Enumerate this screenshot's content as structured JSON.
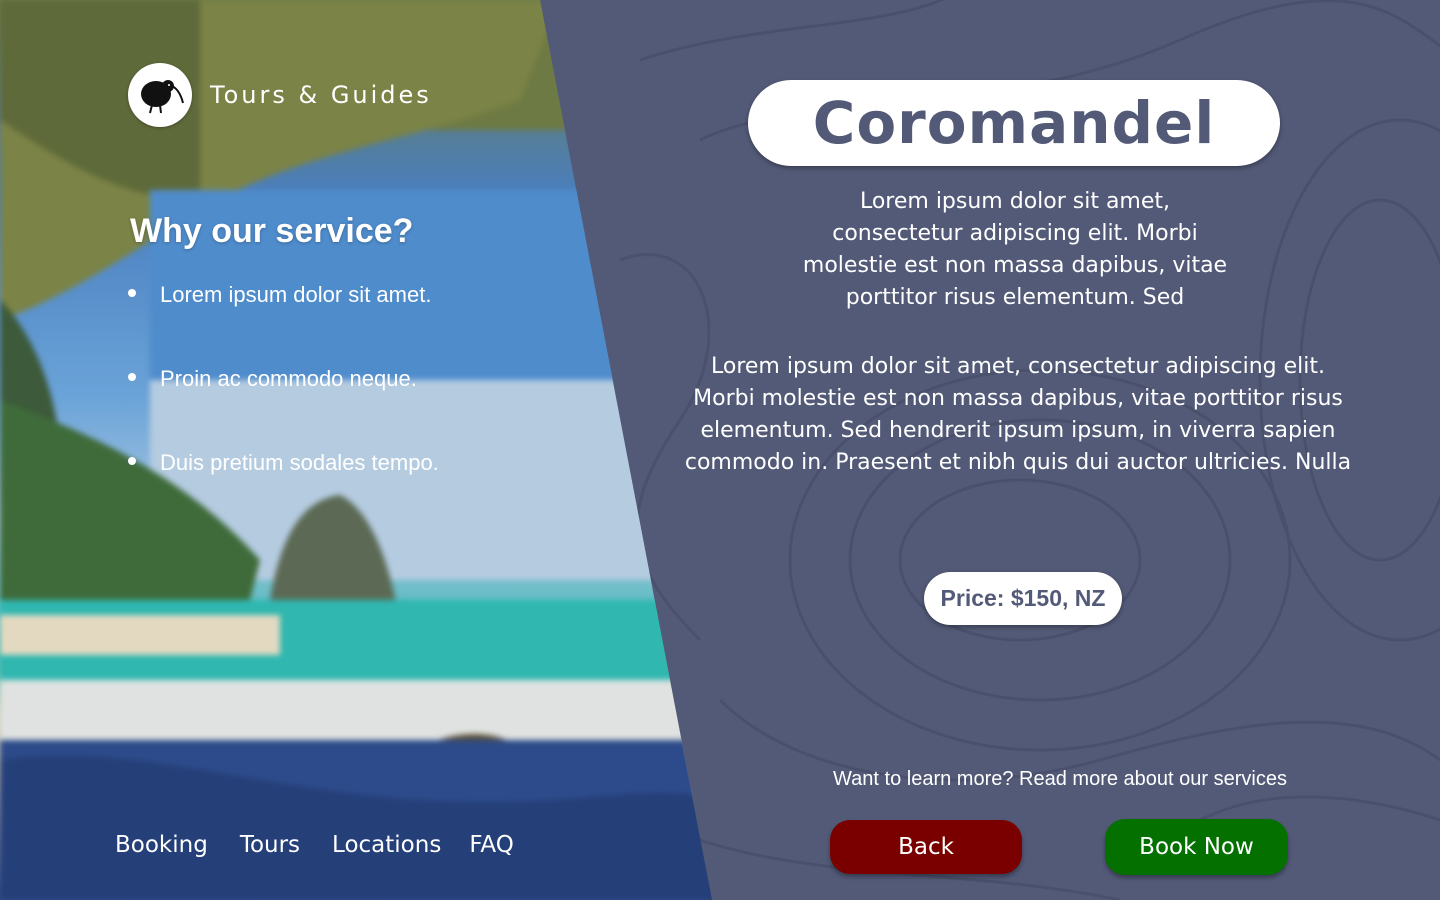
{
  "brand": {
    "name": "Tours & Guides",
    "logo_icon": "kiwi-bird-icon"
  },
  "why": {
    "title": "Why our service?",
    "items": [
      "Lorem ipsum dolor sit amet.",
      "Proin ac commodo neque.",
      "Duis pretium sodales tempo."
    ]
  },
  "nav": {
    "booking": "Booking",
    "tours": "Tours",
    "locations": "Locations",
    "faq": "FAQ"
  },
  "location": {
    "title": "Coromandel",
    "intro": "Lorem ipsum dolor sit amet, consectetur adipiscing elit. Morbi molestie est non massa dapibus, vitae porttitor risus elementum. Sed",
    "body": "Lorem ipsum dolor sit amet, consectetur adipiscing elit. Morbi molestie est non massa dapibus, vitae porttitor risus elementum. Sed hendrerit ipsum ipsum, in viverra sapien commodo in. Praesent et nibh quis dui auctor ultricies. Nulla",
    "price": "Price: $150, NZ"
  },
  "learn_more": "Want to learn more? Read more about our services",
  "buttons": {
    "back": "Back",
    "book": "Book Now"
  },
  "colors": {
    "background": "#535a77",
    "back_button": "#7a0000",
    "book_button": "#037000",
    "pill": "#ffffff"
  }
}
